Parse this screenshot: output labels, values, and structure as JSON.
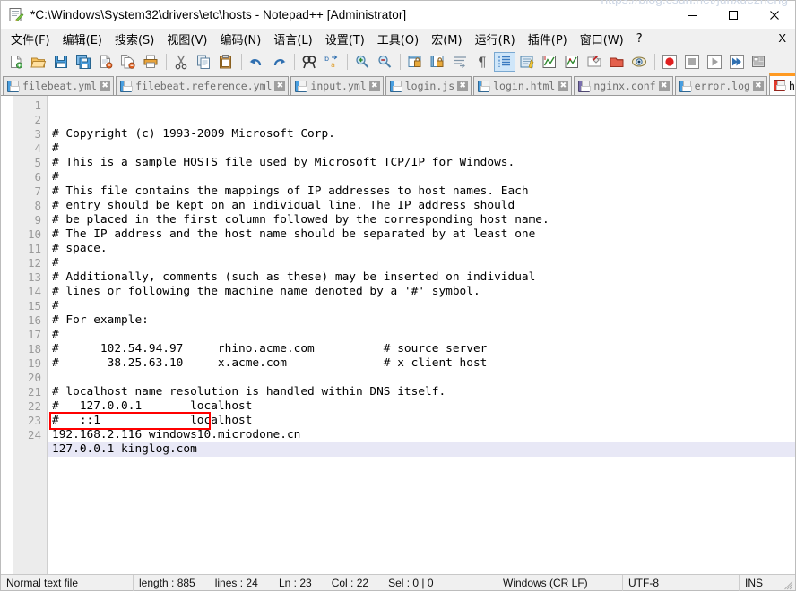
{
  "window": {
    "title": "*C:\\Windows\\System32\\drivers\\etc\\hosts - Notepad++ [Administrator]",
    "app_icon": "notepad-plus-plus-icon",
    "minimize_label": "─",
    "maximize_label": "□",
    "close_label": "✕"
  },
  "menu": {
    "items": [
      {
        "label": "文件(F)",
        "name": "menu-file"
      },
      {
        "label": "编辑(E)",
        "name": "menu-edit"
      },
      {
        "label": "搜索(S)",
        "name": "menu-search"
      },
      {
        "label": "视图(V)",
        "name": "menu-view"
      },
      {
        "label": "编码(N)",
        "name": "menu-encoding"
      },
      {
        "label": "语言(L)",
        "name": "menu-language"
      },
      {
        "label": "设置(T)",
        "name": "menu-settings"
      },
      {
        "label": "工具(O)",
        "name": "menu-tools"
      },
      {
        "label": "宏(M)",
        "name": "menu-macro"
      },
      {
        "label": "运行(R)",
        "name": "menu-run"
      },
      {
        "label": "插件(P)",
        "name": "menu-plugins"
      },
      {
        "label": "窗口(W)",
        "name": "menu-window"
      },
      {
        "label": "?",
        "name": "menu-help"
      }
    ],
    "close_document_label": "X"
  },
  "toolbar": {
    "buttons": [
      {
        "name": "new-file-icon",
        "type": "icon"
      },
      {
        "name": "open-file-icon",
        "type": "icon"
      },
      {
        "name": "save-file-icon",
        "type": "icon"
      },
      {
        "name": "save-all-icon",
        "type": "icon"
      },
      {
        "name": "close-file-icon",
        "type": "icon"
      },
      {
        "name": "close-all-files-icon",
        "type": "icon"
      },
      {
        "name": "print-icon",
        "type": "icon"
      },
      {
        "name": "separator-1",
        "type": "sep"
      },
      {
        "name": "cut-icon",
        "type": "icon"
      },
      {
        "name": "copy-icon",
        "type": "icon"
      },
      {
        "name": "paste-icon",
        "type": "icon"
      },
      {
        "name": "separator-2",
        "type": "sep"
      },
      {
        "name": "undo-icon",
        "type": "icon"
      },
      {
        "name": "redo-icon",
        "type": "icon"
      },
      {
        "name": "separator-3",
        "type": "sep"
      },
      {
        "name": "find-icon",
        "type": "icon"
      },
      {
        "name": "replace-icon",
        "type": "icon"
      },
      {
        "name": "separator-4",
        "type": "sep"
      },
      {
        "name": "zoom-in-icon",
        "type": "icon"
      },
      {
        "name": "zoom-out-icon",
        "type": "icon"
      },
      {
        "name": "separator-5",
        "type": "sep"
      },
      {
        "name": "sync-vertical-scroll-icon",
        "type": "icon"
      },
      {
        "name": "sync-horizontal-scroll-icon",
        "type": "icon"
      },
      {
        "name": "word-wrap-icon",
        "type": "icon"
      },
      {
        "name": "show-all-characters-icon",
        "type": "icon"
      },
      {
        "name": "indent-guide-icon",
        "type": "icon",
        "active": true
      },
      {
        "name": "user-defined-language-icon",
        "type": "icon"
      },
      {
        "name": "function-list-icon",
        "type": "icon"
      },
      {
        "name": "document-map-icon",
        "type": "icon"
      },
      {
        "name": "folder-as-workspace-icon",
        "type": "icon"
      },
      {
        "name": "document-list-icon",
        "type": "icon"
      },
      {
        "name": "separator-6",
        "type": "sep"
      },
      {
        "name": "record-macro-icon",
        "type": "icon"
      },
      {
        "name": "stop-macro-icon",
        "type": "icon"
      },
      {
        "name": "play-macro-icon",
        "type": "icon"
      },
      {
        "name": "run-macro-multiple-icon",
        "type": "icon"
      },
      {
        "name": "save-macro-icon",
        "type": "icon"
      }
    ]
  },
  "tabs": {
    "items": [
      {
        "label": "filebeat.yml",
        "icon": "floppy-blue-icon",
        "active": false
      },
      {
        "label": "filebeat.reference.yml",
        "icon": "floppy-blue-icon",
        "active": false
      },
      {
        "label": "input.yml",
        "icon": "floppy-blue-icon",
        "active": false
      },
      {
        "label": "login.js",
        "icon": "floppy-blue-icon",
        "active": false
      },
      {
        "label": "login.html",
        "icon": "floppy-blue-icon",
        "active": false
      },
      {
        "label": "nginx.conf",
        "icon": "floppy-purple-icon",
        "active": false
      },
      {
        "label": "error.log",
        "icon": "floppy-blue-icon",
        "active": false
      },
      {
        "label": "hosts",
        "icon": "floppy-red-icon",
        "active": true
      }
    ],
    "close_glyph": "✖",
    "nav_prev": "◀",
    "nav_next": "▶"
  },
  "editor": {
    "current_line": 23,
    "lines": [
      {
        "no": "1",
        "text": "# Copyright (c) 1993-2009 Microsoft Corp."
      },
      {
        "no": "2",
        "text": "#"
      },
      {
        "no": "3",
        "text": "# This is a sample HOSTS file used by Microsoft TCP/IP for Windows."
      },
      {
        "no": "4",
        "text": "#"
      },
      {
        "no": "5",
        "text": "# This file contains the mappings of IP addresses to host names. Each"
      },
      {
        "no": "6",
        "text": "# entry should be kept on an individual line. The IP address should"
      },
      {
        "no": "7",
        "text": "# be placed in the first column followed by the corresponding host name."
      },
      {
        "no": "8",
        "text": "# The IP address and the host name should be separated by at least one"
      },
      {
        "no": "9",
        "text": "# space."
      },
      {
        "no": "10",
        "text": "#"
      },
      {
        "no": "11",
        "text": "# Additionally, comments (such as these) may be inserted on individual"
      },
      {
        "no": "12",
        "text": "# lines or following the machine name denoted by a '#' symbol."
      },
      {
        "no": "13",
        "text": "#"
      },
      {
        "no": "14",
        "text": "# For example:"
      },
      {
        "no": "15",
        "text": "#"
      },
      {
        "no": "16",
        "text": "#      102.54.94.97     rhino.acme.com          # source server"
      },
      {
        "no": "17",
        "text": "#       38.25.63.10     x.acme.com              # x client host"
      },
      {
        "no": "18",
        "text": ""
      },
      {
        "no": "19",
        "text": "# localhost name resolution is handled within DNS itself."
      },
      {
        "no": "20",
        "text": "#   127.0.0.1       localhost"
      },
      {
        "no": "21",
        "text": "#   ::1             localhost"
      },
      {
        "no": "22",
        "text": "192.168.2.116 windows10.microdone.cn"
      },
      {
        "no": "23",
        "text": "127.0.0.1 kinglog.com"
      },
      {
        "no": "24",
        "text": ""
      }
    ],
    "annotation": {
      "name": "red-highlight-box",
      "target_line": "127.0.0.1 kinglog.com",
      "color": "#ff0000"
    },
    "current_line_color": "#e8e8f6"
  },
  "statusbar": {
    "file_type": "Normal text file",
    "length_label": "length : 885",
    "lines_label": "lines : 24",
    "ln_label": "Ln : 23",
    "col_label": "Col : 22",
    "sel_label": "Sel : 0 | 0",
    "eol": "Windows (CR LF)",
    "encoding": "UTF-8",
    "insert_mode": "INS"
  },
  "watermark": {
    "text": "https://blog.csdn.net/junxuezheng"
  }
}
